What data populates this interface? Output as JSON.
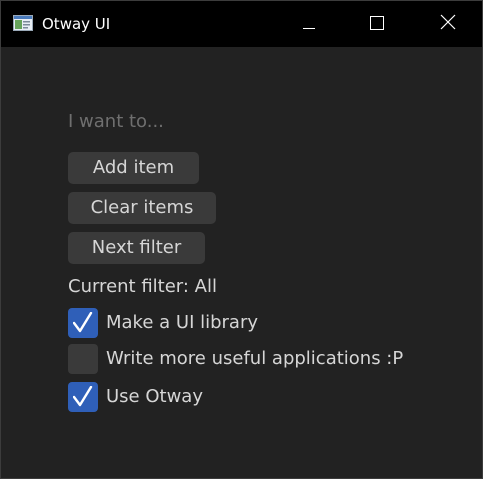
{
  "window": {
    "title": "Otway UI",
    "icon": "app-window-icon",
    "controls": [
      "minimize-icon",
      "maximize-icon",
      "close-icon"
    ]
  },
  "input": {
    "placeholder": "I want to...",
    "value": ""
  },
  "buttons": {
    "add": "Add item",
    "clear": "Clear items",
    "next_filter": "Next filter"
  },
  "filter": {
    "text": "Current filter: All"
  },
  "tasks": [
    {
      "label": "Make a UI library",
      "checked": true
    },
    {
      "label": "Write more useful applications :P",
      "checked": false
    },
    {
      "label": "Use Otway",
      "checked": true
    }
  ],
  "colors": {
    "background": "#222222",
    "titlebar": "#000000",
    "button": "#3a3a3a",
    "checked": "#2f5fb8",
    "text": "#d6d6d6",
    "placeholder": "#6f6f6f"
  }
}
